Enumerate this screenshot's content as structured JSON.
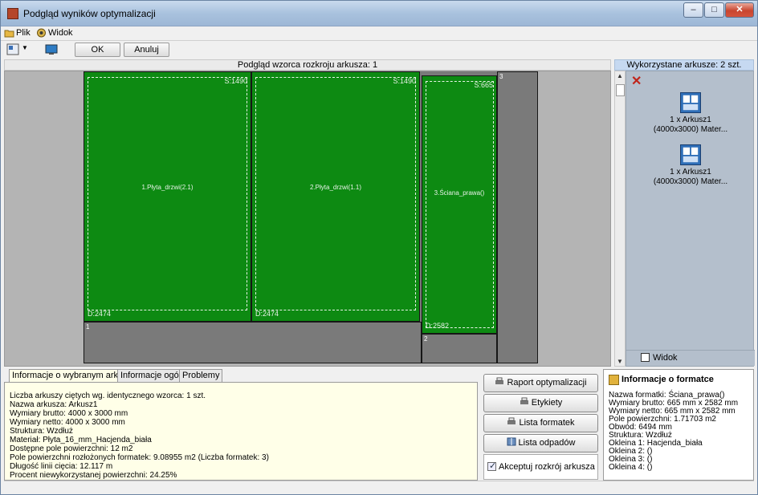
{
  "window": {
    "title": "Podgląd wyników optymalizacji"
  },
  "menu": [
    {
      "label": "Plik",
      "icon": "folder-icon"
    },
    {
      "label": "Widok",
      "icon": "view-icon"
    }
  ],
  "toolbar": {
    "ok_label": "OK",
    "cancel_label": "Anuluj"
  },
  "preview": {
    "header": "Podgląd wzorca rozkroju arkusza: 1",
    "panels": [
      {
        "size_top": "S:1490",
        "size_left": "D:2474",
        "label": "1.Płyta_drzwi(2.1)"
      },
      {
        "size_top": "S:1490",
        "size_left": "D:2474",
        "label": "2.Płyta_drzwi(1.1)"
      },
      {
        "size_top": "S:665",
        "size_left": "D:2582",
        "label": "3.Ściana_prawa()"
      }
    ],
    "waste_labels": [
      "1",
      "2",
      "3"
    ]
  },
  "sheets": {
    "header": "Wykorzystane arkusze: 2 szt.",
    "items": [
      {
        "line1": "1 x Arkusz1",
        "line2": "(4000x3000) Mater..."
      },
      {
        "line1": "1 x Arkusz1",
        "line2": "(4000x3000) Mater..."
      }
    ],
    "view_label": "Widok"
  },
  "tabs": [
    "Informacje o wybranym arkuszu",
    "Informacje ogólne",
    "Problemy"
  ],
  "sheet_info": [
    "Liczba arkuszy ciętych wg. identycznego wzorca: 1 szt.",
    "Nazwa arkusza: Arkusz1",
    "Wymiary brutto: 4000 x 3000 mm",
    "Wymiary netto: 4000 x 3000 mm",
    "Struktura: Wzdłuż",
    "Materiał: Płyta_16_mm_Hacjenda_biała",
    "Dostępne pole powierzchni: 12 m2",
    "Pole powierzchni rozłożonych formatek: 9.08955 m2  (Liczba formatek: 3)",
    "Długość linii cięcia: 12.117 m",
    "Procent niewykorzystanej powierzchni: 24.25%"
  ],
  "actions": {
    "report": "Raport optymalizacji",
    "labels": "Etykiety",
    "format_list": "Lista formatek",
    "waste_list": "Lista odpadów",
    "accept": "Akceptuj rozkrój arkusza"
  },
  "format_info": {
    "title": "Informacje o formatce",
    "lines": [
      "Nazwa formatki: Ściana_prawa()",
      "Wymiary brutto: 665 mm x 2582 mm",
      "Wymiary netto: 665 mm x 2582 mm",
      "Pole powierzchni: 1.71703 m2",
      "Obwód: 6494 mm",
      "Struktura: Wzdłuż",
      "Okleina 1: Hacjenda_biała",
      "Okleina 2: ()",
      "Okleina 3: ()",
      "Okleina 4: ()"
    ]
  },
  "colors": {
    "panel": "#0d8a12",
    "waste": "#7a7a7a",
    "accent": "#c6d9f1"
  }
}
